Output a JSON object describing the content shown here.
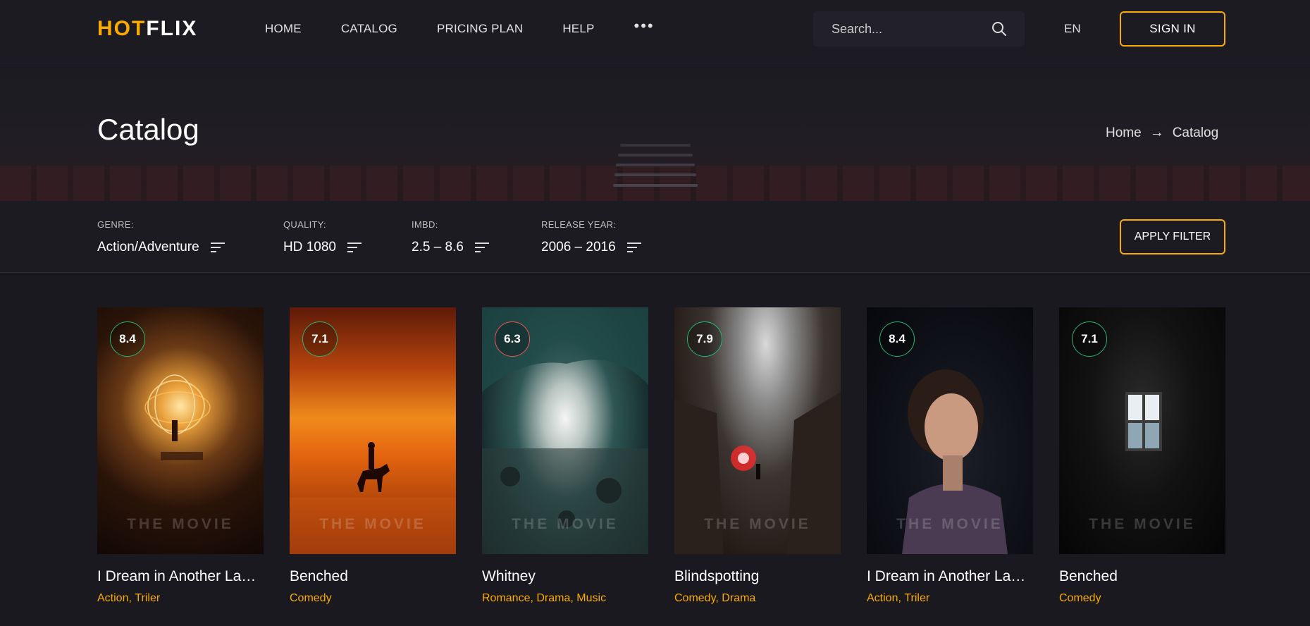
{
  "header": {
    "logo_hot": "HOT",
    "logo_flix": "FLIX",
    "nav": [
      "HOME",
      "CATALOG",
      "PRICING PLAN",
      "HELP"
    ],
    "more_label": "•••",
    "search_placeholder": "Search...",
    "lang": "EN",
    "signin_label": "SIGN IN"
  },
  "title_band": {
    "title": "Catalog",
    "breadcrumb": [
      "Home",
      "Catalog"
    ],
    "breadcrumb_arrow": "→"
  },
  "filters": {
    "items": [
      {
        "label": "GENRE:",
        "value": "Action/Adventure"
      },
      {
        "label": "QUALITY:",
        "value": "HD 1080"
      },
      {
        "label": "IMBd:",
        "value": "2.5 – 8.6"
      },
      {
        "label": "RELEASE YEAR:",
        "value": "2006 – 2016"
      }
    ],
    "apply_label": "APPLY FILTER"
  },
  "cards": [
    {
      "rating": "8.4",
      "rating_color": "green",
      "watermark": "THE MOVIE",
      "title": "I Dream in Another Language",
      "genres": [
        "Action",
        "Triler"
      ]
    },
    {
      "rating": "7.1",
      "rating_color": "green",
      "watermark": "THE MOVIE",
      "title": "Benched",
      "genres": [
        "Comedy"
      ]
    },
    {
      "rating": "6.3",
      "rating_color": "red",
      "watermark": "THE MOVIE",
      "title": "Whitney",
      "genres": [
        "Romance",
        "Drama",
        "Music"
      ]
    },
    {
      "rating": "7.9",
      "rating_color": "green",
      "watermark": "THE MOVIE",
      "title": "Blindspotting",
      "genres": [
        "Comedy",
        "Drama"
      ]
    },
    {
      "rating": "8.4",
      "rating_color": "green",
      "watermark": "THE MOVIE",
      "title": "I Dream in Another Language",
      "genres": [
        "Action",
        "Triler"
      ]
    },
    {
      "rating": "7.1",
      "rating_color": "green",
      "watermark": "THE MOVIE",
      "title": "Benched",
      "genres": [
        "Comedy"
      ]
    }
  ],
  "colors": {
    "accent": "#f9ab00",
    "rating_green": "#29b474",
    "rating_red": "#eb5757",
    "background": "#1a191f"
  }
}
